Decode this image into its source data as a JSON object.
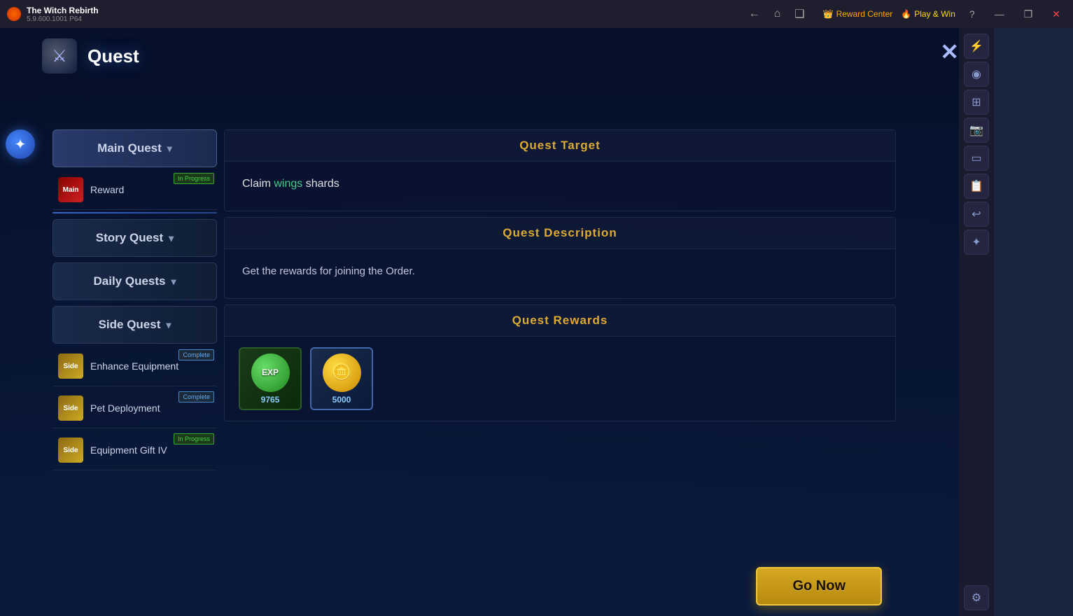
{
  "titleBar": {
    "appName": "The Witch Rebirth",
    "version": "5.9.600.1001 P64",
    "rewardCenter": "Reward Center",
    "playWin": "Play & Win",
    "navBack": "←",
    "navHome": "⌂",
    "navDuplicate": "❑",
    "minimize": "—",
    "restore": "❐",
    "close": "✕"
  },
  "questPanel": {
    "title": "Quest",
    "closeIcon": "✕",
    "categories": [
      {
        "id": "main-quest",
        "label": "Main Quest",
        "active": true
      },
      {
        "id": "story-quest",
        "label": "Story Quest",
        "active": false
      },
      {
        "id": "daily-quests",
        "label": "Daily Quests",
        "active": false
      },
      {
        "id": "side-quest",
        "label": "Side Quest",
        "active": false
      }
    ],
    "subItems": [
      {
        "id": "reward",
        "type": "main",
        "label": "Reward",
        "badge": "In Progress"
      },
      {
        "id": "enhance-equipment",
        "type": "side",
        "label": "Enhance Equipment",
        "badge": "Complete"
      },
      {
        "id": "pet-deployment",
        "type": "side",
        "label": "Pet Deployment",
        "badge": "Complete"
      },
      {
        "id": "equipment-gift-iv",
        "type": "side",
        "label": "Equipment Gift IV",
        "badge": "In Progress"
      }
    ]
  },
  "questDetail": {
    "targetLabel": "Quest Target",
    "targetText": "Claim ",
    "targetHighlight": "wings",
    "targetTextAfter": " shards",
    "descriptionLabel": "Quest Description",
    "descriptionText": "Get the rewards for joining the Order.",
    "rewardsLabel": "Quest Rewards",
    "rewards": [
      {
        "id": "exp-reward",
        "type": "exp",
        "label": "EXP",
        "value": "9765"
      },
      {
        "id": "gold-reward",
        "type": "gold",
        "label": "💰",
        "value": "5000"
      }
    ],
    "goNowButton": "Go Now"
  },
  "rightSidebar": {
    "icons": [
      {
        "id": "icon-1",
        "symbol": "⚡",
        "active": false
      },
      {
        "id": "icon-2",
        "symbol": "◈",
        "active": false
      },
      {
        "id": "icon-3",
        "symbol": "⊞",
        "active": false
      },
      {
        "id": "icon-4",
        "symbol": "📷",
        "active": false
      },
      {
        "id": "icon-5",
        "symbol": "⬜",
        "active": false
      },
      {
        "id": "icon-6",
        "symbol": "📋",
        "active": false
      },
      {
        "id": "icon-7",
        "symbol": "↩",
        "active": false
      },
      {
        "id": "icon-8",
        "symbol": "✦",
        "active": false
      },
      {
        "id": "icon-9",
        "symbol": "⚙",
        "active": false
      }
    ]
  }
}
